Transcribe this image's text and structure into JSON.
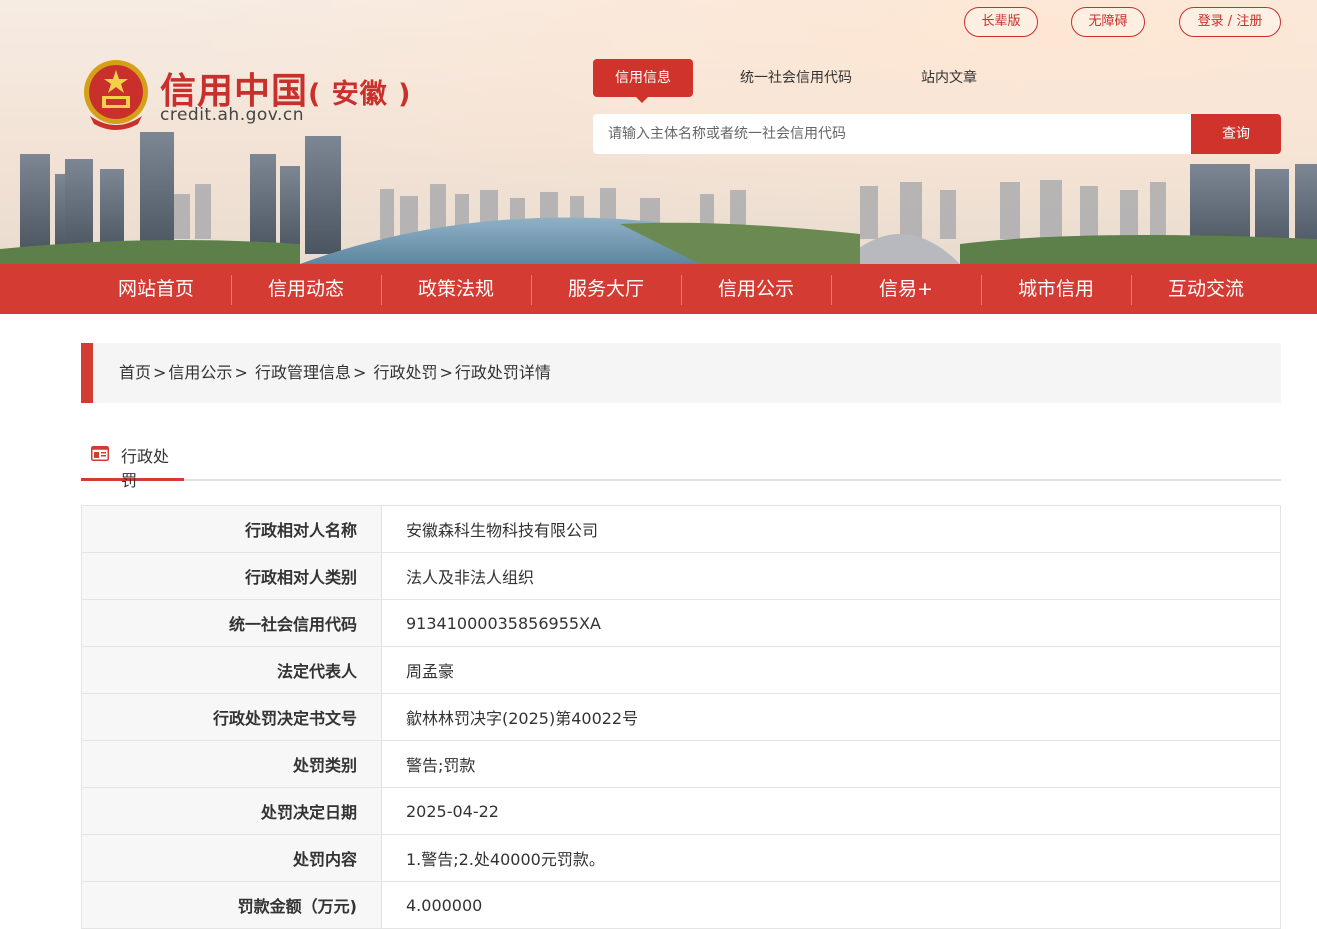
{
  "top_links": {
    "elder": "长辈版",
    "accessible": "无障碍",
    "login": "登录 / 注册"
  },
  "logo": {
    "title": "信用中国",
    "subtitle": "( 安徽 )",
    "url": "credit.ah.gov.cn"
  },
  "search": {
    "tabs": [
      "信用信息",
      "统一社会信用代码",
      "站内文章"
    ],
    "placeholder": "请输入主体名称或者统一社会信用代码",
    "button": "查询"
  },
  "nav": [
    "网站首页",
    "信用动态",
    "政策法规",
    "服务大厅",
    "信用公示",
    "信易+",
    "城市信用",
    "互动交流"
  ],
  "breadcrumb": [
    "首页",
    "信用公示",
    "行政管理信息",
    "行政处罚",
    "行政处罚详情"
  ],
  "section": {
    "title": "行政处罚",
    "icon": "list-card-icon"
  },
  "details": [
    {
      "label": "行政相对人名称",
      "value": "安徽森科生物科技有限公司"
    },
    {
      "label": "行政相对人类别",
      "value": "法人及非法人组织"
    },
    {
      "label": "统一社会信用代码",
      "value": "91341000035856955XA"
    },
    {
      "label": "法定代表人",
      "value": "周孟豪"
    },
    {
      "label": "行政处罚决定书文号",
      "value": "歙林林罚决字(2025)第40022号"
    },
    {
      "label": "处罚类别",
      "value": "警告;罚款"
    },
    {
      "label": "处罚决定日期",
      "value": "2025-04-22"
    },
    {
      "label": "处罚内容",
      "value": "1.警告;2.处40000元罚款。"
    },
    {
      "label": "罚款金额（万元)",
      "value": "4.000000"
    }
  ],
  "colors": {
    "brand_red": "#d33b33",
    "header_bg": "#f3e3d6"
  }
}
